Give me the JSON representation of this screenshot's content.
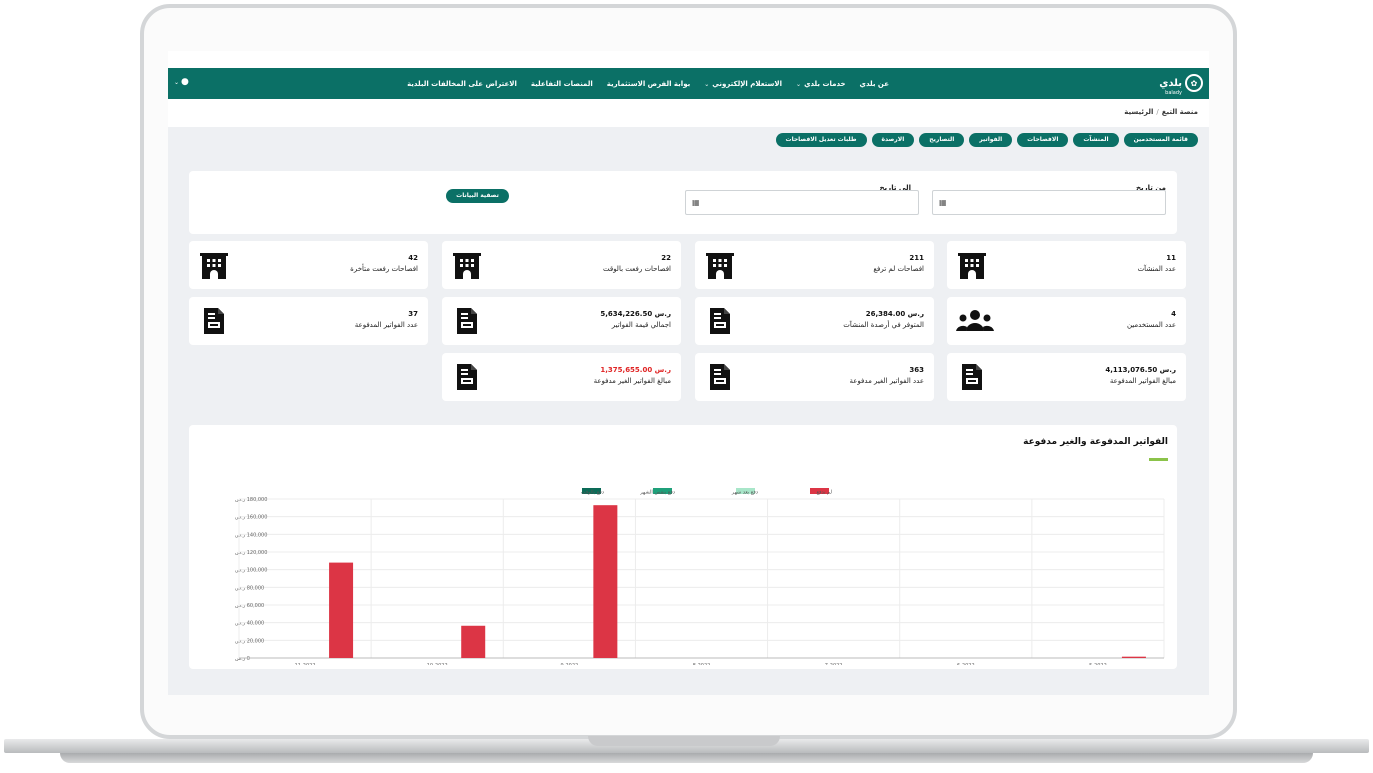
{
  "nav": {
    "brand": "بلدي",
    "brand_sub": "balady",
    "items": [
      {
        "label": "عن بلدي",
        "dropdown": false
      },
      {
        "label": "خدمات بلدي",
        "dropdown": true
      },
      {
        "label": "الاستعلام الإلكتروني",
        "dropdown": true
      },
      {
        "label": "بوابة الفرص الاستثمارية",
        "dropdown": false
      },
      {
        "label": "المنصات التفاعلية",
        "dropdown": false
      },
      {
        "label": "الاعتراض على المخالفات البلدية",
        "dropdown": false
      }
    ]
  },
  "breadcrumb": [
    "منصة التبغ",
    "الرئيسية"
  ],
  "tabs": [
    "قائمة المستخدمين",
    "المنشآت",
    "الافصاحات",
    "الفواتير",
    "التصاريح",
    "الارصدة",
    "طلبات تعديل الافصاحات"
  ],
  "filter": {
    "from_label": "من تاريخ",
    "to_label": "الى تاريخ",
    "button": "تصفية البيانات"
  },
  "stats": [
    {
      "value": "11",
      "label": "عدد المنشآت",
      "icon": "building-icon",
      "red": false
    },
    {
      "value": "211",
      "label": "افصاحات لم ترفع",
      "icon": "building-icon",
      "red": false
    },
    {
      "value": "22",
      "label": "افصاحات رفعت بالوقت",
      "icon": "building-icon",
      "red": false
    },
    {
      "value": "42",
      "label": "افصاحات رفعت متأخرة",
      "icon": "building-icon",
      "red": false
    },
    {
      "value": "4",
      "label": "عدد المستخدمين",
      "icon": "users-icon",
      "red": false
    },
    {
      "value": "26,384.00 ر.س",
      "label": "المتوفر في أرصدة المنشآت",
      "icon": "invoice-icon",
      "red": false
    },
    {
      "value": "5,634,226.50 ر.س",
      "label": "اجمالي قيمة الفواتير",
      "icon": "invoice-icon",
      "red": false
    },
    {
      "value": "37",
      "label": "عدد الفواتير المدفوعة",
      "icon": "invoice-icon",
      "red": false
    },
    {
      "value": "4,113,076.50 ر.س",
      "label": "مبالغ الفواتير المدفوعة",
      "icon": "invoice-icon",
      "red": false
    },
    {
      "value": "363",
      "label": "عدد الفواتير الغير مدفوعة",
      "icon": "invoice-icon",
      "red": false
    },
    {
      "value": "1,375,655.00 ر.س",
      "label": "مبالغ الفواتير الغير مدفوعة",
      "icon": "invoice-icon",
      "red": true
    }
  ],
  "chart_title": "الفواتير المدفوعة والغير مدفوعة",
  "chart_data": {
    "type": "bar",
    "categories": [
      "11-2022",
      "10-2022",
      "9-2022",
      "8-2022",
      "7-2022",
      "6-2022",
      "5-2022"
    ],
    "series": [
      {
        "name": "دفع بالوقت",
        "color": "#0b6b57",
        "values": [
          0,
          0,
          0,
          0,
          0,
          0,
          0
        ]
      },
      {
        "name": "دفع بنفس الشهر",
        "color": "#1fa07a",
        "values": [
          0,
          0,
          0,
          0,
          0,
          0,
          0
        ]
      },
      {
        "name": "دفع بعد شهر",
        "color": "#a8e6c9",
        "values": [
          0,
          0,
          0,
          0,
          0,
          0,
          0
        ]
      },
      {
        "name": "لم تدفع",
        "color": "#dc3545",
        "values": [
          108000,
          36500,
          173000,
          0,
          0,
          0,
          1500
        ]
      }
    ],
    "ylim": [
      0,
      180000
    ],
    "yticks": [
      "0 ر.س",
      "20,000 ر.س",
      "40,000 ر.س",
      "60,000 ر.س",
      "80,000 ر.س",
      "100,000 ر.س",
      "120,000 ر.س",
      "140,000 ر.س",
      "160,000 ر.س",
      "180,000 ر.س"
    ],
    "legend_position": "top"
  }
}
